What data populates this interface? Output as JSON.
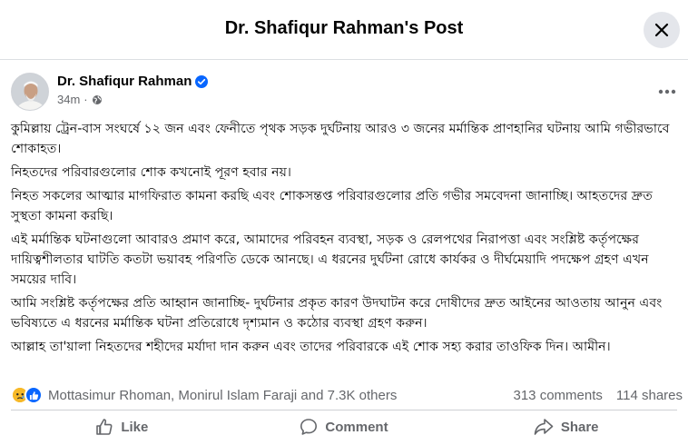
{
  "modal": {
    "title": "Dr. Shafiqur Rahman's Post"
  },
  "post": {
    "author": "Dr. Shafiqur Rahman",
    "time": "34m",
    "paragraphs": [
      "কুমিল্লায় ট্রেন-বাস সংঘর্ষে ১২ জন এবং ফেনীতে পৃথক সড়ক দুর্ঘটনায় আরও ৩ জনের মর্মান্তিক প্রাণহানির ঘটনায় আমি গভীরভাবে শোকাহত।",
      "নিহতদের পরিবারগুলোর শোক কখনোই পূরণ হবার নয়।",
      "নিহত সকলের আত্মার মাগফিরাত কামনা করছি এবং শোকসন্তপ্ত পরিবারগুলোর প্রতি গভীর সমবেদনা জানাচ্ছি। আহতদের দ্রুত সুস্থতা কামনা করছি।",
      "এই মর্মান্তিক ঘটনাগুলো আবারও প্রমাণ করে, আমাদের পরিবহন ব্যবস্থা, সড়ক ও রেলপথের নিরাপত্তা এবং সংশ্লিষ্ট কর্তৃপক্ষের দায়িত্বশীলতার ঘাটতি কতটা ভয়াবহ পরিণতি ডেকে আনছে। এ ধরনের দুর্ঘটনা রোধে কার্যকর ও দীর্ঘমেয়াদি পদক্ষেপ গ্রহণ এখন সময়ের দাবি।",
      "আমি সংশ্লিষ্ট কর্তৃপক্ষের প্রতি আহ্বান জানাচ্ছি- দুর্ঘটনার প্রকৃত কারণ উদঘাটন করে দোষীদের দ্রুত আইনের আওতায় আনুন এবং ভবিষ্যতে এ ধরনের মর্মান্তিক ঘটনা প্রতিরোধে দৃশ্যমান ও কঠোর ব্যবস্থা গ্রহণ করুন।",
      "আল্লাহ তা'য়ালা নিহতদের শহীদের মর্যাদা দান করুন এবং তাদের পরিবারকে এই শোক সহ্য করার তাওফিক দিন। আমীন।"
    ]
  },
  "reactions": {
    "icons": [
      "sad-emoji-icon",
      "like-emoji-icon"
    ],
    "names": "Mottasimur Rhoman, Monirul Islam Faraji and 7.3K others",
    "comments": "313 comments",
    "shares": "114 shares"
  },
  "actions": {
    "like": "Like",
    "comment": "Comment",
    "share": "Share"
  },
  "colors": {
    "verified": "#0866ff",
    "secondary_text": "#65676b",
    "close_bg": "#e4e6eb"
  }
}
